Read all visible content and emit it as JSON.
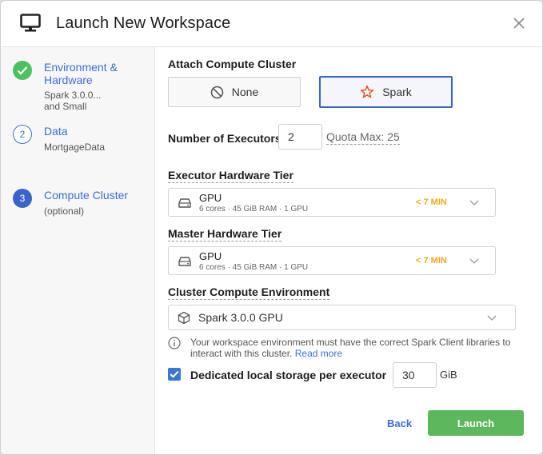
{
  "dialog": {
    "title": "Launch New Workspace"
  },
  "steps": [
    {
      "number": "1",
      "title": "Environment &",
      "title2": "Hardware",
      "sub1": "Spark 3.0.0...",
      "sub2": "and Small",
      "status": "complete"
    },
    {
      "number": "2",
      "title": "Data",
      "sub1": "MortgageData",
      "status": "pending"
    },
    {
      "number": "3",
      "title": "Compute Cluster",
      "sub1": "(optional)",
      "status": "active"
    }
  ],
  "cluster": {
    "label": "Attach Compute Cluster",
    "options": [
      {
        "label": "None",
        "icon": "ban-icon",
        "selected": false
      },
      {
        "label": "Spark",
        "icon": "spark-star-icon",
        "selected": true
      }
    ]
  },
  "executors": {
    "label": "Number of Executors",
    "value": "2",
    "quota": "Quota Max: 25"
  },
  "executor_tier": {
    "label": "Executor Hardware Tier",
    "name": "GPU",
    "specs": "6 cores · 45 GiB RAM · 1 GPU",
    "eta": "< 7 MIN"
  },
  "master_tier": {
    "label": "Master Hardware Tier",
    "name": "GPU",
    "specs": "6 cores · 45 GiB RAM · 1 GPU",
    "eta": "< 7 MIN"
  },
  "environment": {
    "label": "Cluster Compute Environment",
    "value": "Spark 3.0.0 GPU",
    "info_line1": "Your workspace environment must have the correct Spark Client libraries to",
    "info_line2": "interact with this cluster.",
    "read_more": "Read more"
  },
  "storage": {
    "label": "Dedicated local storage per executor",
    "value": "30",
    "unit": "GiB",
    "checked": true
  },
  "footer": {
    "back": "Back",
    "launch": "Launch"
  },
  "colors": {
    "accent": "#3a6fd8",
    "success": "#5cb85c",
    "warning": "#f2a81b",
    "spark": "#e8562c"
  }
}
